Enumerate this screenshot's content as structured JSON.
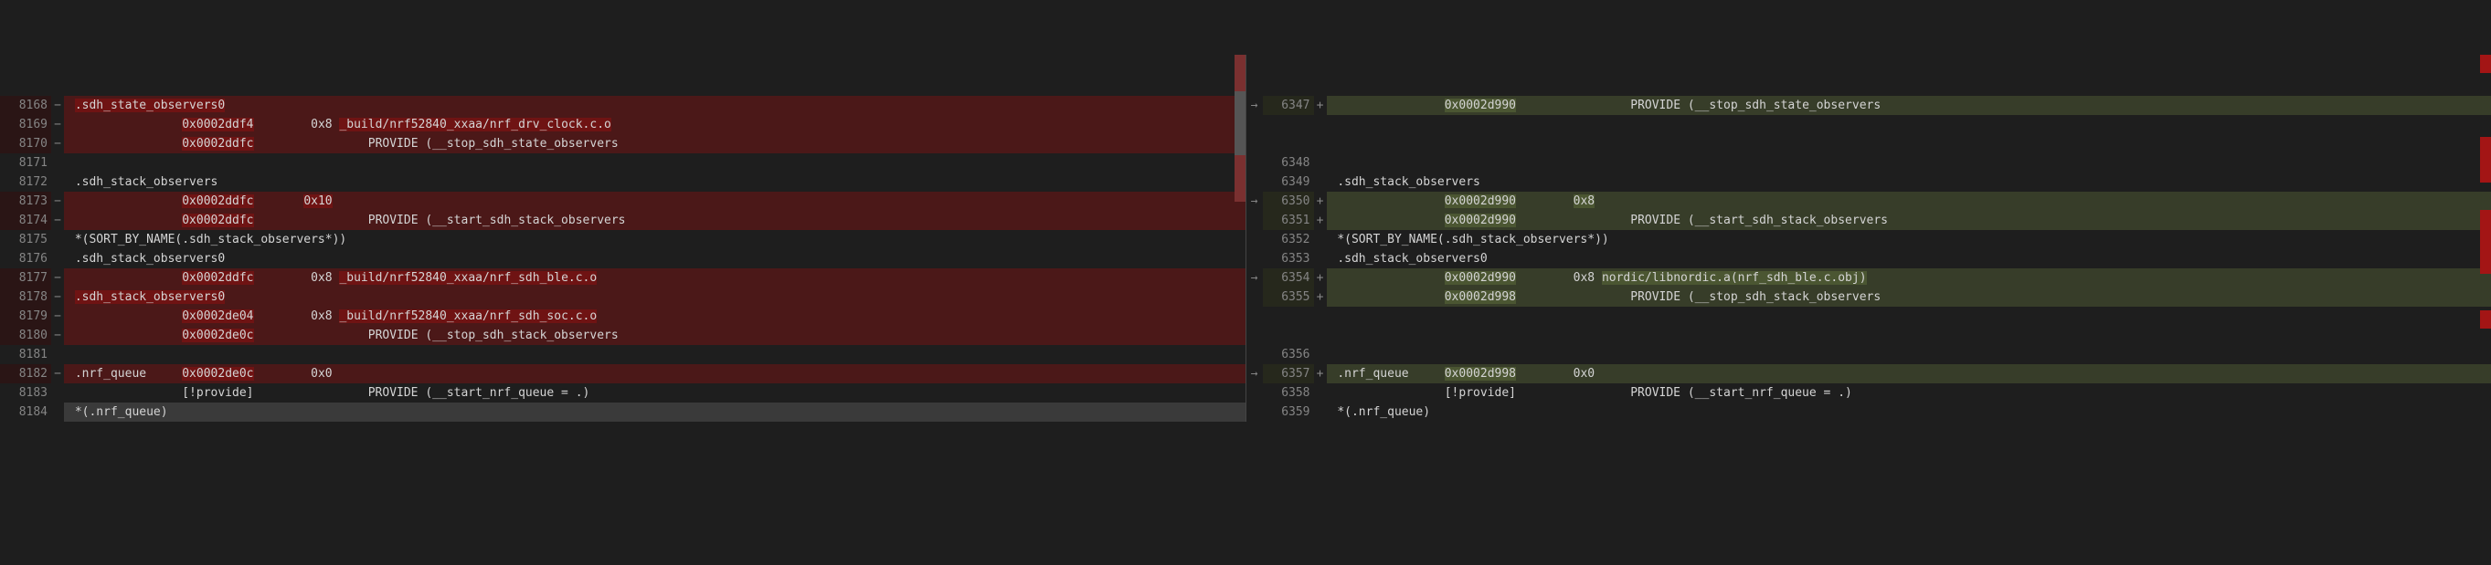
{
  "left": [
    {
      "ln": "8168",
      "sign": "−",
      "cls": "del",
      "text": " .sdh_state_observers0",
      "hl": [
        [
          1,
          22
        ]
      ]
    },
    {
      "ln": "8169",
      "sign": "−",
      "cls": "del",
      "text": "                0x0002ddf4        0x8 _build/nrf52840_xxaa/nrf_drv_clock.c.o",
      "hl": [
        [
          16,
          10
        ],
        [
          38,
          38
        ]
      ]
    },
    {
      "ln": "8170",
      "sign": "−",
      "cls": "del",
      "text": "                0x0002ddfc                PROVIDE (__stop_sdh_state_observers",
      "hl": [
        [
          16,
          10
        ]
      ]
    },
    {
      "ln": "8171",
      "sign": "",
      "cls": "",
      "text": ""
    },
    {
      "ln": "8172",
      "sign": "",
      "cls": "",
      "text": " .sdh_stack_observers"
    },
    {
      "ln": "8173",
      "sign": "−",
      "cls": "del",
      "text": "                0x0002ddfc       0x10",
      "hl": [
        [
          16,
          10
        ],
        [
          33,
          4
        ]
      ]
    },
    {
      "ln": "8174",
      "sign": "−",
      "cls": "del",
      "text": "                0x0002ddfc                PROVIDE (__start_sdh_stack_observers",
      "hl": [
        [
          16,
          10
        ]
      ]
    },
    {
      "ln": "8175",
      "sign": "",
      "cls": "",
      "text": " *(SORT_BY_NAME(.sdh_stack_observers*))"
    },
    {
      "ln": "8176",
      "sign": "",
      "cls": "",
      "text": " .sdh_stack_observers0"
    },
    {
      "ln": "8177",
      "sign": "−",
      "cls": "del",
      "text": "                0x0002ddfc        0x8 _build/nrf52840_xxaa/nrf_sdh_ble.c.o",
      "hl": [
        [
          16,
          10
        ],
        [
          38,
          36
        ]
      ]
    },
    {
      "ln": "8178",
      "sign": "−",
      "cls": "del",
      "text": " .sdh_stack_observers0",
      "hl": [
        [
          1,
          21
        ]
      ]
    },
    {
      "ln": "8179",
      "sign": "−",
      "cls": "del",
      "text": "                0x0002de04        0x8 _build/nrf52840_xxaa/nrf_sdh_soc.c.o",
      "hl": [
        [
          16,
          10
        ],
        [
          38,
          36
        ]
      ]
    },
    {
      "ln": "8180",
      "sign": "−",
      "cls": "del",
      "text": "                0x0002de0c                PROVIDE (__stop_sdh_stack_observers",
      "hl": [
        [
          16,
          10
        ]
      ]
    },
    {
      "ln": "8181",
      "sign": "",
      "cls": "",
      "text": ""
    },
    {
      "ln": "8182",
      "sign": "−",
      "cls": "del",
      "text": " .nrf_queue     0x0002de0c        0x0",
      "hl": [
        [
          16,
          10
        ]
      ]
    },
    {
      "ln": "8183",
      "sign": "",
      "cls": "",
      "text": "                [!provide]                PROVIDE (__start_nrf_queue = .)"
    },
    {
      "ln": "8184",
      "sign": "",
      "cls": "sel",
      "text": " *(.nrf_queue)"
    }
  ],
  "right": [
    {
      "ln": "6347",
      "sign": "+",
      "cls": "add",
      "arrow": true,
      "text": "                0x0002d990                PROVIDE (__stop_sdh_state_observers",
      "hl": [
        [
          16,
          10
        ]
      ]
    },
    {
      "ln": "",
      "sign": "",
      "cls": "placeholder",
      "text": ""
    },
    {
      "ln": "",
      "sign": "",
      "cls": "placeholder",
      "text": ""
    },
    {
      "ln": "6348",
      "sign": "",
      "cls": "",
      "text": ""
    },
    {
      "ln": "6349",
      "sign": "",
      "cls": "",
      "text": " .sdh_stack_observers"
    },
    {
      "ln": "6350",
      "sign": "+",
      "cls": "add",
      "arrow": true,
      "text": "                0x0002d990        0x8",
      "hl": [
        [
          16,
          10
        ],
        [
          34,
          3
        ]
      ]
    },
    {
      "ln": "6351",
      "sign": "+",
      "cls": "add",
      "text": "                0x0002d990                PROVIDE (__start_sdh_stack_observers",
      "hl": [
        [
          16,
          10
        ]
      ]
    },
    {
      "ln": "6352",
      "sign": "",
      "cls": "",
      "text": " *(SORT_BY_NAME(.sdh_stack_observers*))"
    },
    {
      "ln": "6353",
      "sign": "",
      "cls": "",
      "text": " .sdh_stack_observers0"
    },
    {
      "ln": "6354",
      "sign": "+",
      "cls": "add",
      "arrow": true,
      "text": "                0x0002d990        0x8 nordic/libnordic.a(nrf_sdh_ble.c.obj)",
      "hl": [
        [
          16,
          10
        ],
        [
          38,
          37
        ]
      ]
    },
    {
      "ln": "6355",
      "sign": "+",
      "cls": "add",
      "text": "                0x0002d998                PROVIDE (__stop_sdh_stack_observers",
      "hl": [
        [
          16,
          10
        ]
      ]
    },
    {
      "ln": "",
      "sign": "",
      "cls": "placeholder",
      "text": ""
    },
    {
      "ln": "",
      "sign": "",
      "cls": "placeholder",
      "text": ""
    },
    {
      "ln": "6356",
      "sign": "",
      "cls": "",
      "text": ""
    },
    {
      "ln": "6357",
      "sign": "+",
      "cls": "add",
      "arrow": true,
      "text": " .nrf_queue     0x0002d998        0x0",
      "hl": [
        [
          16,
          10
        ]
      ]
    },
    {
      "ln": "6358",
      "sign": "",
      "cls": "",
      "text": "                [!provide]                PROVIDE (__start_nrf_queue = .)"
    },
    {
      "ln": "6359",
      "sign": "",
      "cls": "",
      "text": " *(.nrf_queue)"
    }
  ]
}
